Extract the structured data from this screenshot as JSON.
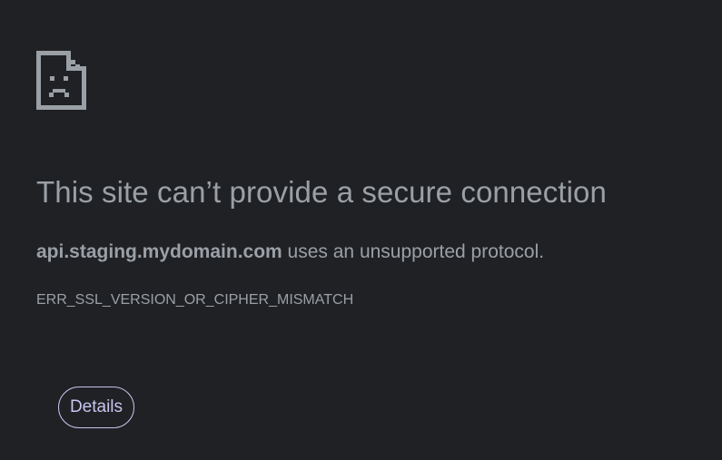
{
  "error": {
    "icon": "sad-page-icon",
    "title": "This site can’t provide a secure connection",
    "host": "api.staging.mydomain.com",
    "message": " uses an unsupported protocol.",
    "code": "ERR_SSL_VERSION_OR_CIPHER_MISMATCH"
  },
  "actions": {
    "details_label": "Details"
  },
  "colors": {
    "background": "#202124",
    "text": "#9aa0a6",
    "button_border": "#c5c0ec",
    "button_text": "#c7c4f0"
  }
}
